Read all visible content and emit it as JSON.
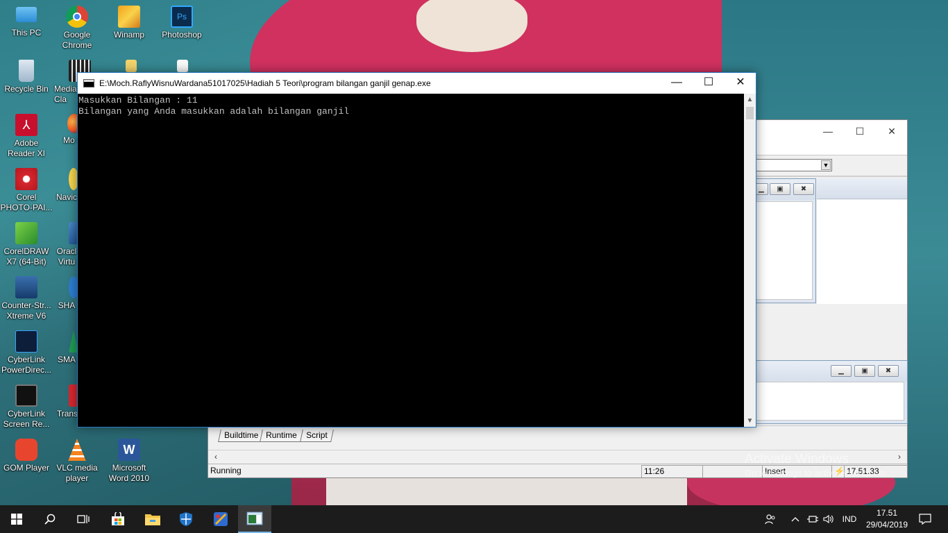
{
  "desktop": {
    "icons": [
      {
        "label": "This PC",
        "icon": "this-pc-icon"
      },
      {
        "label": "Google Chrome",
        "icon": "chrome-icon"
      },
      {
        "label": "Winamp",
        "icon": "winamp-icon"
      },
      {
        "label": "Photoshop",
        "icon": "photoshop-icon"
      },
      {
        "label": "Recycle Bin",
        "icon": "recycle-bin-icon"
      },
      {
        "label": "Media Cla",
        "icon": "media-player-classic-icon"
      },
      {
        "label": "Adobe Reader XI",
        "icon": "adobe-reader-icon"
      },
      {
        "label": "Mo Fire",
        "icon": "firefox-icon"
      },
      {
        "label": "Corel PHOTO-PAI...",
        "icon": "corel-photopaint-icon"
      },
      {
        "label": "Navic",
        "icon": "navicat-icon"
      },
      {
        "label": "CorelDRAW X7 (64-Bit)",
        "icon": "coreldraw-icon"
      },
      {
        "label": "Oracl Virtu",
        "icon": "virtualbox-icon"
      },
      {
        "label": "Counter-Str... Xtreme V6",
        "icon": "counter-strike-icon"
      },
      {
        "label": "SHA",
        "icon": "sha-icon"
      },
      {
        "label": "CyberLink PowerDirec...",
        "icon": "powerdirector-icon"
      },
      {
        "label": "SMA",
        "icon": "sma-icon"
      },
      {
        "label": "CyberLink Screen Re...",
        "icon": "screen-recorder-icon"
      },
      {
        "label": "Trans",
        "icon": "trans-icon"
      },
      {
        "label": "GOM Player",
        "icon": "gom-player-icon"
      },
      {
        "label": "VLC media player",
        "icon": "vlc-icon"
      },
      {
        "label": "Microsoft Word 2010",
        "icon": "word-icon"
      }
    ]
  },
  "console": {
    "title": "E:\\Moch.RaflyWisnuWardana51017025\\Hadiah 5 Teori\\program bilangan ganjil genap.exe",
    "lines": [
      "Masukkan Bilangan : 11",
      "Bilangan yang Anda masukkan adalah bilangan ganjil"
    ],
    "controls": {
      "minimize": "—",
      "maximize": "☐",
      "close": "✕"
    }
  },
  "background_app": {
    "controls": {
      "minimize": "—",
      "maximize": "☐",
      "close": "✕"
    },
    "tabs": [
      "Buildtime",
      "Runtime",
      "Script"
    ],
    "status": {
      "state": "Running",
      "position": "11:26",
      "mode": "Insert",
      "time": "17.51.33"
    },
    "watermark_line1": "Activate Windows",
    "watermark_line2": "Go to Settings to activate Windows."
  },
  "taskbar": {
    "language": "IND",
    "time": "17.51",
    "date": "29/04/2019",
    "apps": [
      "start-icon",
      "search-icon",
      "task-view-icon",
      "store-icon",
      "file-explorer-icon",
      "security-icon",
      "app-icon",
      "console-app-icon"
    ]
  },
  "colors": {
    "console_bg": "#000000",
    "console_text": "#c0c0c0",
    "taskbar_bg": "#1c1c1c",
    "accent": "#76b9ed"
  }
}
